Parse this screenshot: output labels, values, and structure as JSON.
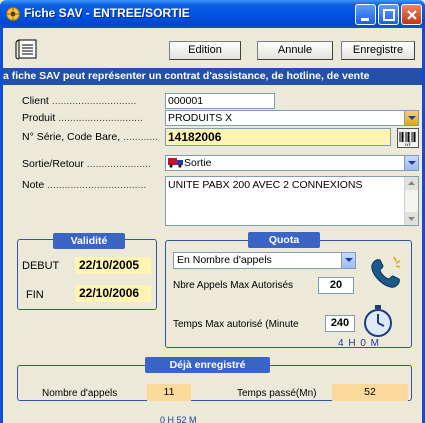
{
  "window": {
    "title": "Fiche SAV - ENTREE/SORTIE",
    "colors": {
      "titlebar": "#0054e3",
      "banner": "#2450a8",
      "group_title": "#3a64c5",
      "highlight_yellow": "#fff4b3",
      "summary_orange": "#fad99a"
    }
  },
  "toolbar": {
    "edition": "Edition",
    "annule": "Annule",
    "enregistre": "Enregistre"
  },
  "banner": "a fiche SAV peut représenter un contrat d'assistance, de hotline, de vente",
  "form": {
    "client_label": "Client",
    "client_value": "000001",
    "produit_label": "Produit",
    "produit_value": "PRODUITS X",
    "serie_label": "N° Série, Code Bare,",
    "serie_value": "14182006",
    "sortie_label": "Sortie/Retour",
    "sortie_value": "Sortie",
    "note_label": "Note",
    "note_value": "UNITE PABX 200 AVEC 2 CONNEXIONS"
  },
  "validite": {
    "title": "Validité",
    "debut_label": "DEBUT",
    "debut_value": "22/10/2005",
    "fin_label": "FIN",
    "fin_value": "22/10/2006"
  },
  "quota": {
    "title": "Quota",
    "mode_selected": "En Nombre d'appels",
    "max_appels_label": "Nbre Appels Max Autorisés",
    "max_appels_value": "20",
    "temps_max_label": "Temps Max autorisé (Minute",
    "temps_max_value": "240",
    "temps_readout": "4 H 0  M"
  },
  "deja": {
    "title": "Déjà enregistré",
    "nombre_label": "Nombre d'appels",
    "nombre_value": "11",
    "temps_label": "Temps passé(Mn)",
    "temps_value": "52",
    "footer_readout": "0 H 52 M"
  }
}
